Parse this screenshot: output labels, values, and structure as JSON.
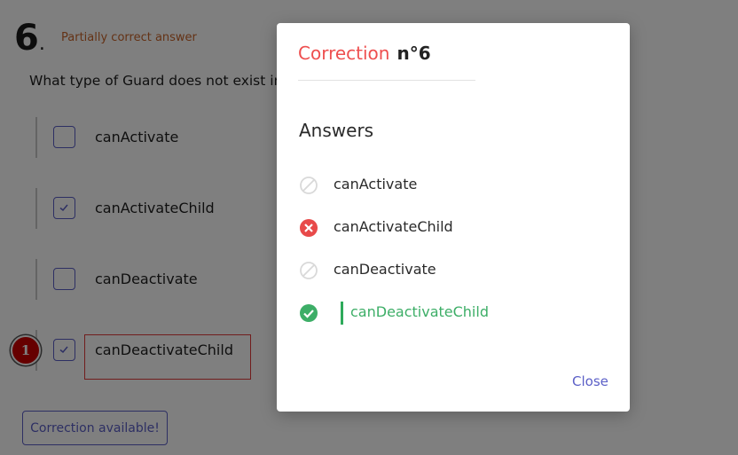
{
  "question": {
    "number": "6",
    "number_suffix": ".",
    "status": "Partially correct answer",
    "text": "What type of Guard does not exist in Angular?",
    "options": [
      {
        "label": "canActivate",
        "checked": false
      },
      {
        "label": "canActivateChild",
        "checked": true
      },
      {
        "label": "canDeactivate",
        "checked": false
      },
      {
        "label": "canDeactivateChild",
        "checked": true
      }
    ],
    "marker": "1",
    "correction_button": "Correction available!"
  },
  "modal": {
    "title_word": "Correction",
    "title_number": "n°6",
    "answers_heading": "Answers",
    "answers": [
      {
        "label": "canActivate",
        "state": "neutral",
        "icon": "prohibited-icon"
      },
      {
        "label": "canActivateChild",
        "state": "wrong",
        "icon": "cross-circle-icon"
      },
      {
        "label": "canDeactivate",
        "state": "neutral",
        "icon": "prohibited-icon"
      },
      {
        "label": "canDeactivateChild",
        "state": "correct",
        "icon": "check-circle-icon"
      }
    ],
    "close_label": "Close"
  },
  "colors": {
    "accent": "#5b5fc7",
    "wrong": "#e84a4a",
    "correct": "#3dae67",
    "status": "#c9652a"
  }
}
